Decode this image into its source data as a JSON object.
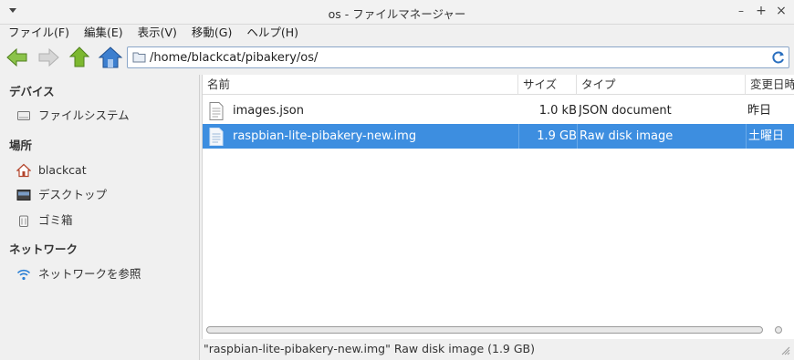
{
  "window": {
    "title": "os - ファイルマネージャー"
  },
  "menubar": {
    "items": [
      {
        "label": "ファイル(F)"
      },
      {
        "label": "編集(E)"
      },
      {
        "label": "表示(V)"
      },
      {
        "label": "移動(G)"
      },
      {
        "label": "ヘルプ(H)"
      }
    ]
  },
  "toolbar": {
    "path": "/home/blackcat/pibakery/os/"
  },
  "sidebar": {
    "devices_heading": "デバイス",
    "filesystem_label": "ファイルシステム",
    "places_heading": "場所",
    "home_label": "blackcat",
    "desktop_label": "デスクトップ",
    "trash_label": "ゴミ箱",
    "network_heading": "ネットワーク",
    "browse_network_label": "ネットワークを参照"
  },
  "filelist": {
    "columns": {
      "name": "名前",
      "size": "サイズ",
      "type": "タイプ",
      "modified": "変更日時"
    },
    "rows": [
      {
        "name": "images.json",
        "size": "1.0 kB",
        "type": "JSON document",
        "modified": "昨日",
        "selected": false
      },
      {
        "name": "raspbian-lite-pibakery-new.img",
        "size": "1.9 GB",
        "type": "Raw disk image",
        "modified": "土曜日",
        "selected": true
      }
    ]
  },
  "statusbar": {
    "text": "\"raspbian-lite-pibakery-new.img\" Raw disk image (1.9 GB)"
  },
  "colors": {
    "selection": "#3d8ee0",
    "nav_arrow": "#8bc34a",
    "up_arrow": "#7cb82f",
    "home": "#3d7fcf"
  }
}
